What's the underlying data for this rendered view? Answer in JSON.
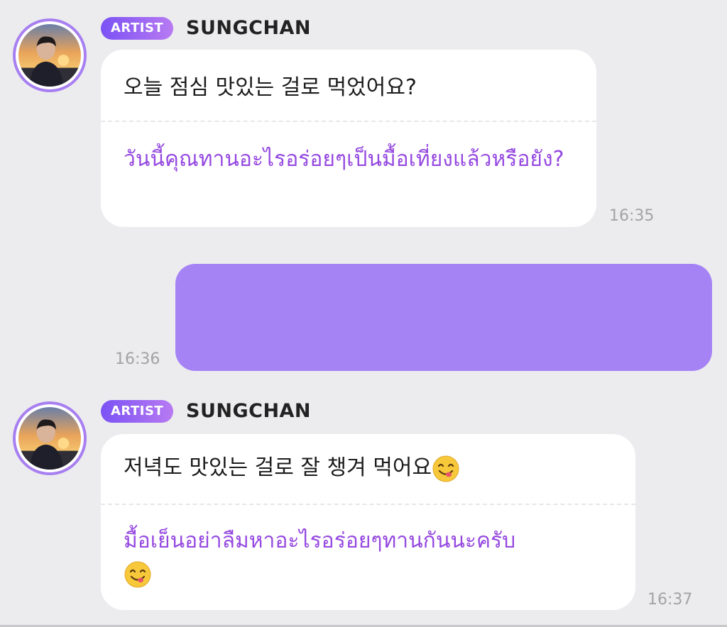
{
  "messages": [
    {
      "badge": "ARTIST",
      "sender": "SUNGCHAN",
      "original": "오늘 점심 맛있는 걸로 먹었어요?",
      "translation": "วันนี้คุณทานอะไรอร่อยๆเป็นมื้อเที่ยงแล้วหรือยัง?",
      "time": "16:35"
    },
    {
      "time": "16:36"
    },
    {
      "badge": "ARTIST",
      "sender": "SUNGCHAN",
      "original": "저녁도 맛있는 걸로 잘 챙겨 먹어요",
      "translation": "มื้อเย็นอย่าลืมหาอะไรอร่อยๆทานกันนะครับ",
      "time": "16:37"
    }
  ],
  "colors": {
    "background": "#ececef",
    "sent_bubble": "#a583f5",
    "translation_text": "#9549e0",
    "badge_start": "#7b52f4",
    "badge_end": "#b77af2"
  },
  "icons": {
    "avatar": "profile-photo-sunset",
    "emoji": "face-savoring-food"
  }
}
